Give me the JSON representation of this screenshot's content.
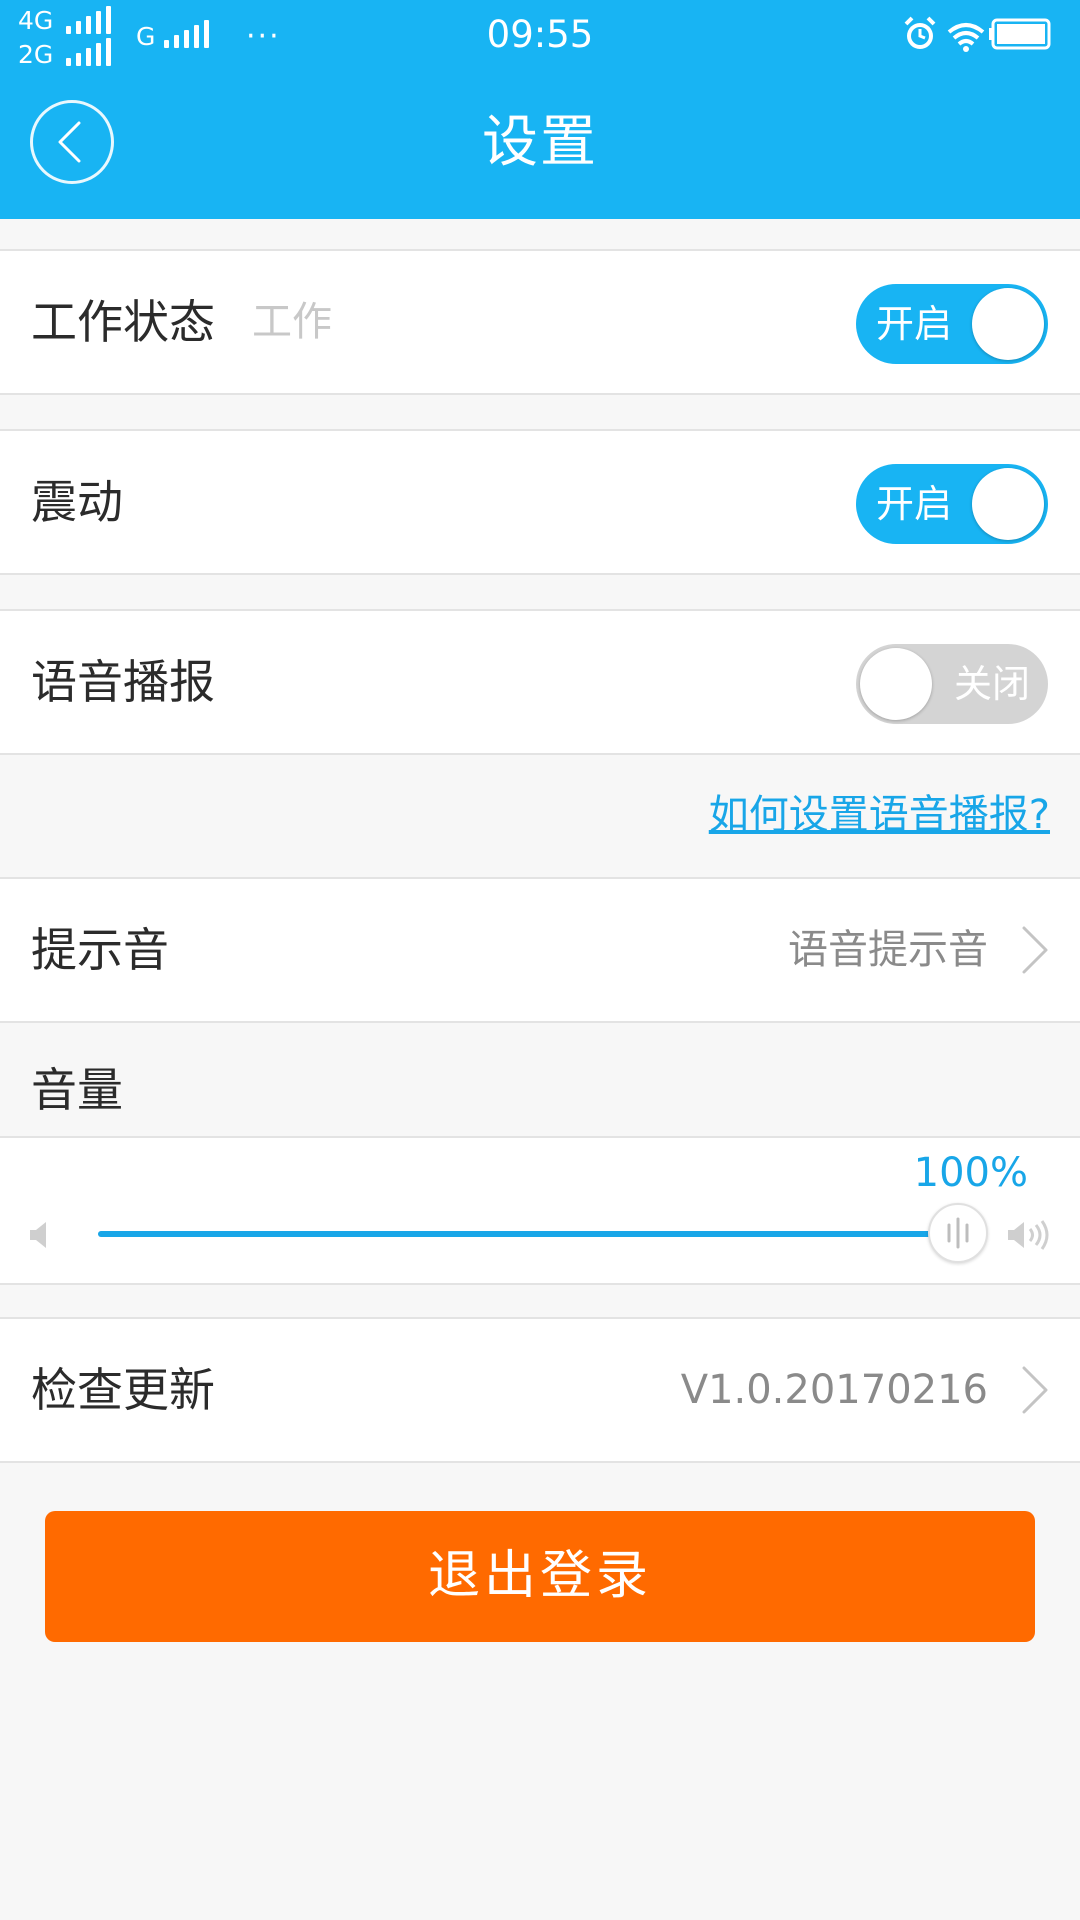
{
  "status_bar": {
    "network_top": "4G",
    "network_bottom": "2G",
    "network_secondary": "G",
    "more": "···",
    "time": "09:55"
  },
  "nav": {
    "title": "设置"
  },
  "settings": {
    "work_status": {
      "label": "工作状态",
      "sub": "工作",
      "toggle_text": "开启",
      "on": true
    },
    "vibrate": {
      "label": "震动",
      "toggle_text": "开启",
      "on": true
    },
    "voice_broadcast": {
      "label": "语音播报",
      "toggle_text": "关闭",
      "on": false
    },
    "help_link": "如何设置语音播报?",
    "prompt_sound": {
      "label": "提示音",
      "value": "语音提示音"
    },
    "volume": {
      "label": "音量",
      "percent_text": "100%",
      "level": 1.0
    },
    "check_update": {
      "label": "检查更新",
      "value": "V1.0.20170216"
    }
  },
  "logout": {
    "label": "退出登录"
  },
  "colors": {
    "primary": "#18b4f3",
    "accent_text": "#18a6e8",
    "logout": "#ff6a00",
    "toggle_off": "#d4d4d4"
  }
}
